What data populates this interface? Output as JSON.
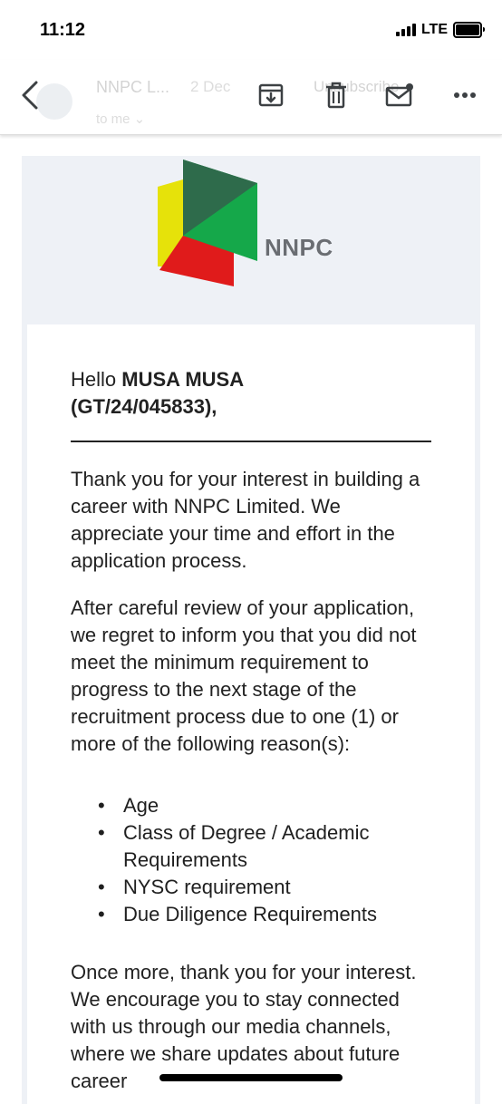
{
  "status_bar": {
    "time": "11:12",
    "network": "LTE"
  },
  "toolbar": {
    "faded_sender_name": "NNPC L...",
    "faded_date": "2 Dec",
    "faded_to": "to me ⌄",
    "faded_unsubscribe": "Unsubscribe",
    "icons": [
      "back-icon",
      "archive-icon",
      "delete-icon",
      "mark-unread-icon",
      "more-icon"
    ]
  },
  "email": {
    "logo_text": "NNPC",
    "greeting_prefix": "Hello ",
    "greeting_name": "MUSA MUSA",
    "greeting_id": "(GT/24/045833),",
    "paragraph1": "Thank you for your interest in building a career with NNPC Limited. We appreciate your time and effort in the application process.",
    "paragraph2": "After careful review of your application, we regret to inform you that you did not meet the minimum requirement to progress to the next stage of the recruitment process due to one (1) or more of the following reason(s):",
    "reasons": [
      "Age",
      "Class of Degree / Academic Requirements",
      "NYSC requirement",
      "Due Diligence Requirements"
    ],
    "paragraph3": "Once more, thank you for your interest. We encourage you to stay connected with us through our media channels, where we share updates about future career"
  },
  "colors": {
    "logo_dark_green": "#2e6b4b",
    "logo_green": "#15a84a",
    "logo_yellow": "#e6e20a",
    "logo_red": "#e01b1b",
    "header_band": "#eef1f6"
  }
}
